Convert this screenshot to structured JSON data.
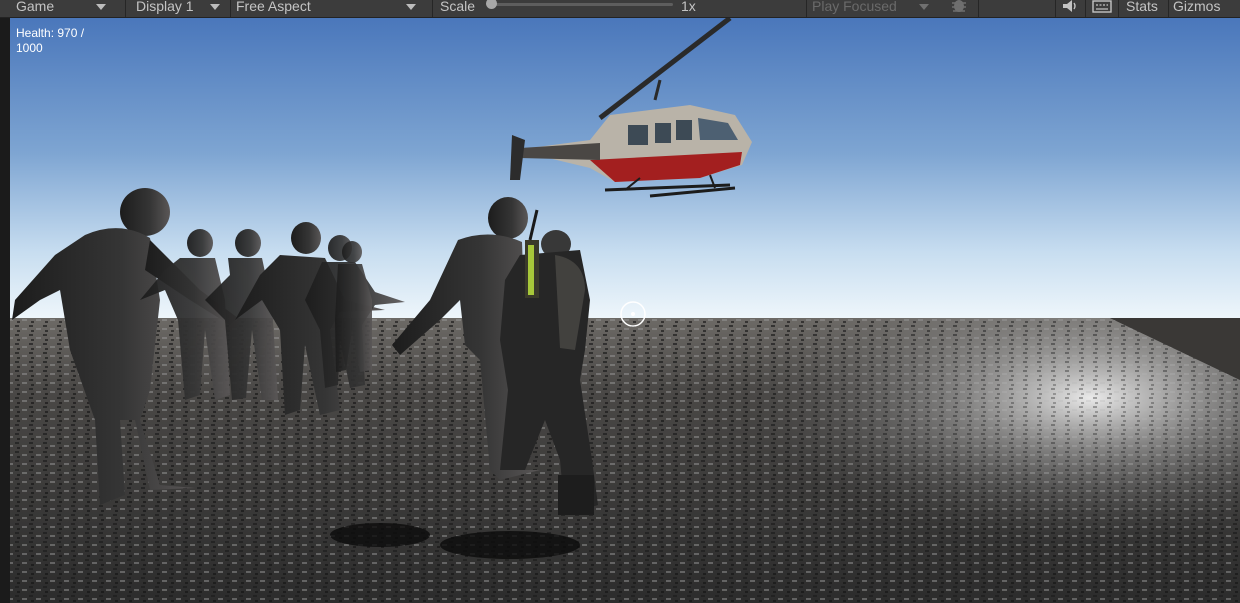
{
  "toolbar": {
    "view_mode": "Game",
    "display": "Display 1",
    "aspect": "Free Aspect",
    "scale_label": "Scale",
    "scale_value": 0,
    "scale_text": "1x",
    "play_mode": "Play Focused",
    "bug_icon": "bug-icon",
    "audio_icon": "speaker-icon",
    "keyboard_icon": "keyboard-icon",
    "stats": "Stats",
    "gizmos": "Gizmos"
  },
  "hud": {
    "health": "Health: 970 / 1000",
    "crosshair_icon": "crosshair-icon"
  },
  "scene": {
    "sky_top": "#4f7bbd",
    "sky_horizon": "#e8f2fa",
    "ground": "#3d3d3d",
    "helicopter_stripe": "#a31f1f",
    "enemies": [
      "zombie-1",
      "zombie-2",
      "zombie-3",
      "zombie-4",
      "zombie-5",
      "zombie-6",
      "zombie-7"
    ],
    "player": "armored-soldier"
  }
}
